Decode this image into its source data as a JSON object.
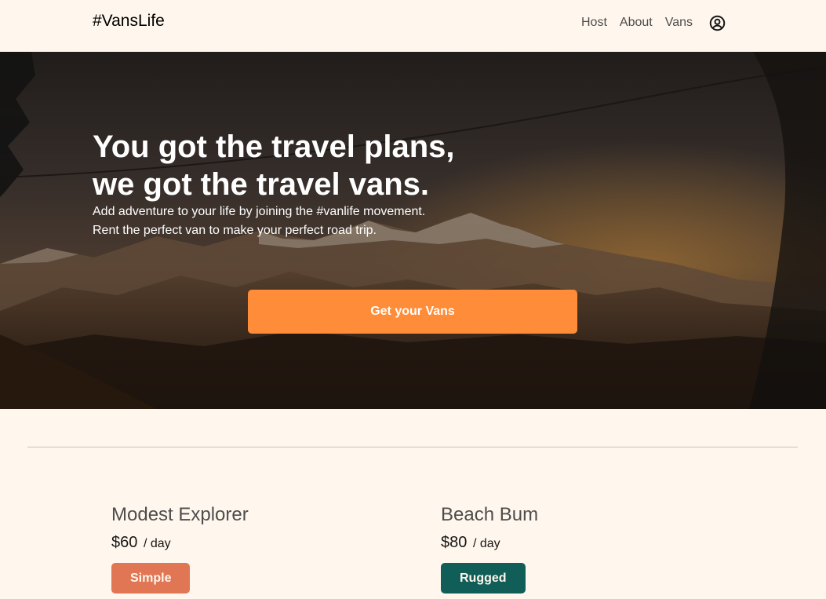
{
  "nav": {
    "logo": "#VansLife",
    "links": [
      "Host",
      "About",
      "Vans"
    ],
    "user_icon": "user-circle-icon"
  },
  "hero": {
    "title_line1": "You got the travel plans,",
    "title_line2": "we got the travel vans.",
    "subtitle_line1": "Add adventure to your life by joining the #vanlife movement.",
    "subtitle_line2": "Rent the perfect van to make your perfect road trip.",
    "cta_label": "Get your Vans",
    "cta_color": "#FF8C38"
  },
  "vans": [
    {
      "name": "Modest Explorer",
      "price": "$60",
      "per_day": "/ day",
      "type": "Simple",
      "type_color": "#E17654"
    },
    {
      "name": "Beach Bum",
      "price": "$80",
      "per_day": "/ day",
      "type": "Rugged",
      "type_color": "#115E59"
    }
  ]
}
